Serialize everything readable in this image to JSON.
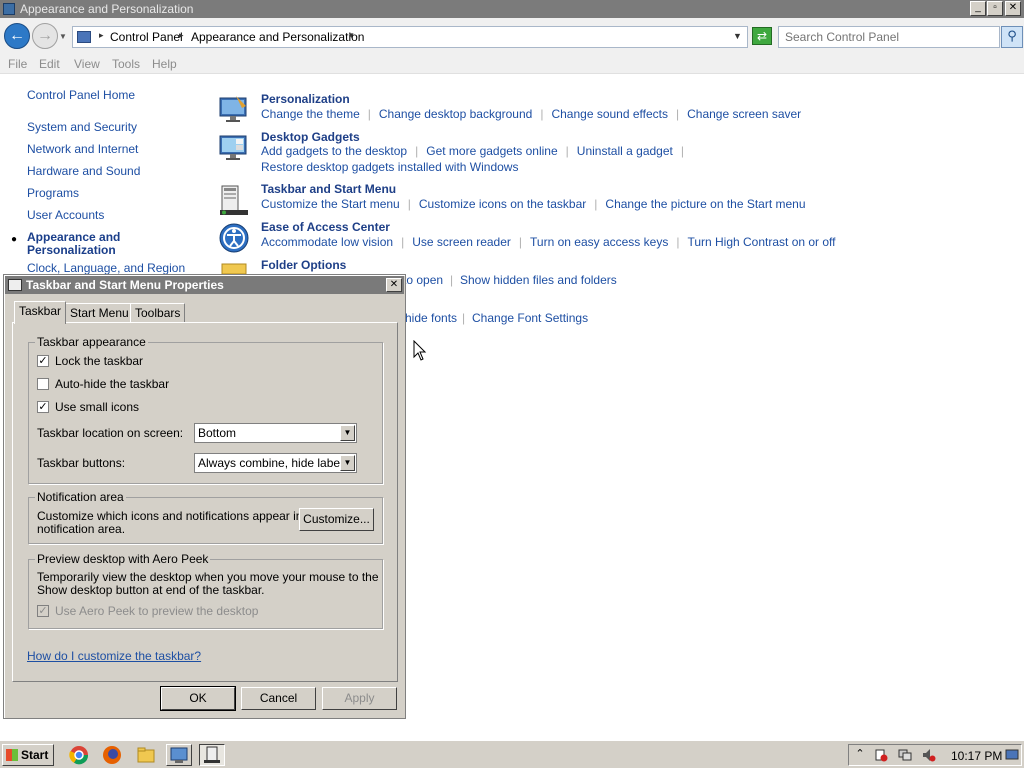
{
  "window": {
    "title": "Appearance and Personalization"
  },
  "address": {
    "crumbs": [
      "Control Panel",
      "Appearance and Personalization"
    ],
    "search_placeholder": "Search Control Panel"
  },
  "menu": [
    "File",
    "Edit",
    "View",
    "Tools",
    "Help"
  ],
  "leftnav": {
    "home": "Control Panel Home",
    "items": [
      "System and Security",
      "Network and Internet",
      "Hardware and Sound",
      "Programs",
      "User Accounts"
    ],
    "current_line1": "Appearance and",
    "current_line2": "Personalization",
    "partial": "Clock, Language, and Region"
  },
  "categories": {
    "personalization": {
      "title": "Personalization",
      "links": [
        "Change the theme",
        "Change desktop background",
        "Change sound effects",
        "Change screen saver"
      ]
    },
    "gadgets": {
      "title": "Desktop Gadgets",
      "links": [
        "Add gadgets to the desktop",
        "Get more gadgets online",
        "Uninstall a gadget"
      ],
      "extra": "Restore desktop gadgets installed with Windows"
    },
    "taskbar": {
      "title": "Taskbar and Start Menu",
      "links": [
        "Customize the Start menu",
        "Customize icons on the taskbar",
        "Change the picture on the Start menu"
      ]
    },
    "ease": {
      "title": "Ease of Access Center",
      "links": [
        "Accommodate low vision",
        "Use screen reader",
        "Turn on easy access keys",
        "Turn High Contrast on or off"
      ]
    },
    "folder": {
      "title": "Folder Options",
      "visible_links": [
        "to open",
        "Show hidden files and folders"
      ]
    },
    "fonts": {
      "visible_links": [
        "hide fonts",
        "Change Font Settings"
      ]
    }
  },
  "dialog": {
    "title": "Taskbar and Start Menu Properties",
    "tabs": [
      "Taskbar",
      "Start Menu",
      "Toolbars"
    ],
    "appearance": {
      "label": "Taskbar appearance",
      "lock": {
        "label": "Lock the taskbar",
        "checked": true
      },
      "autohide": {
        "label": "Auto-hide the taskbar",
        "checked": false
      },
      "small_icons": {
        "label": "Use small icons",
        "checked": true
      },
      "location_label": "Taskbar location on screen:",
      "location_value": "Bottom",
      "buttons_label": "Taskbar buttons:",
      "buttons_value": "Always combine, hide labels"
    },
    "notification": {
      "label": "Notification area",
      "desc_line1": "Customize which icons and notifications appear in the",
      "desc_line2": "notification area.",
      "button": "Customize..."
    },
    "peek": {
      "label": "Preview desktop with Aero Peek",
      "desc_line1": "Temporarily view the desktop when you move your mouse to the",
      "desc_line2": "Show desktop button at end of the taskbar.",
      "checkbox_label": "Use Aero Peek to preview the desktop",
      "checked": true
    },
    "help_link": "How do I customize the taskbar?",
    "buttons": {
      "ok": "OK",
      "cancel": "Cancel",
      "apply": "Apply"
    }
  },
  "taskbar": {
    "start": "Start",
    "clock": "10:17 PM"
  }
}
